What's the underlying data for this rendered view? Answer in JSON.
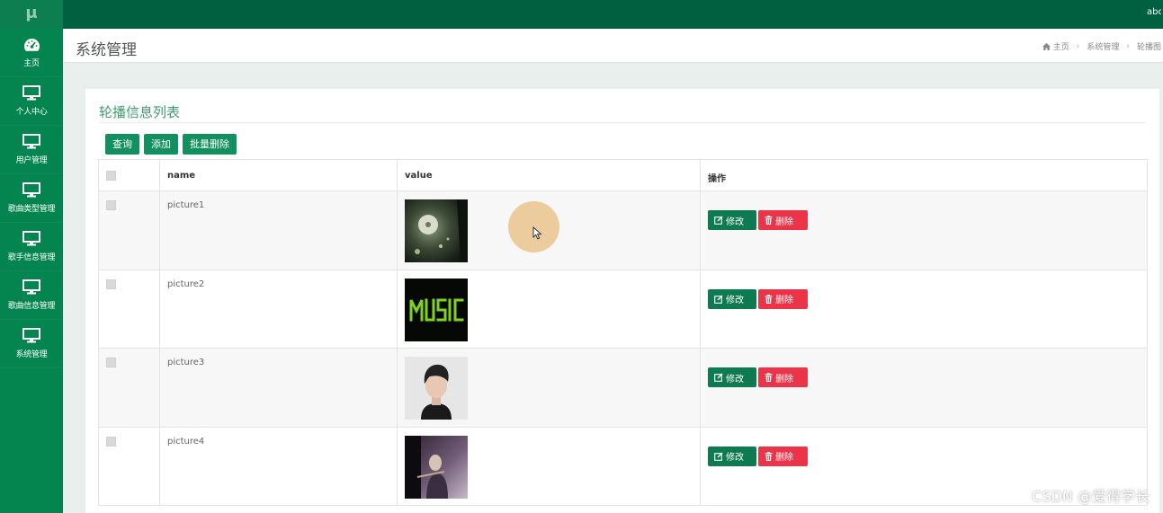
{
  "app": {
    "logo": "μ",
    "user": "abc"
  },
  "sidebar": {
    "items": [
      {
        "label": "主页",
        "icon": "dashboard-icon"
      },
      {
        "label": "个人中心",
        "icon": "monitor-icon"
      },
      {
        "label": "用户管理",
        "icon": "monitor-icon"
      },
      {
        "label": "歌曲类型管理",
        "icon": "monitor-icon"
      },
      {
        "label": "歌手信息管理",
        "icon": "monitor-icon"
      },
      {
        "label": "歌曲信息管理",
        "icon": "monitor-icon"
      },
      {
        "label": "系统管理",
        "icon": "monitor-icon"
      }
    ]
  },
  "header": {
    "title": "系统管理",
    "breadcrumb": {
      "home": "主页",
      "section": "系统管理",
      "current": "轮播图"
    }
  },
  "card": {
    "title": "轮播信息列表",
    "buttons": {
      "search": "查询",
      "add": "添加",
      "batch_delete": "批量删除"
    }
  },
  "table": {
    "columns": {
      "name": "name",
      "value": "value",
      "ops": "操作"
    },
    "rows": [
      {
        "name": "picture1",
        "image": "record-player-thumbnail"
      },
      {
        "name": "picture2",
        "image": "music-text-thumbnail"
      },
      {
        "name": "picture3",
        "image": "person-portrait-thumbnail"
      },
      {
        "name": "picture4",
        "image": "guitar-player-thumbnail"
      }
    ],
    "edit_label": "修改",
    "delete_label": "删除"
  },
  "watermark": "CSDN @爱得学长",
  "colors": {
    "topbar": "#01603f",
    "sidebar": "#04844f",
    "primary": "#129060",
    "danger": "#ec3448",
    "title_green": "#3f9d73"
  }
}
